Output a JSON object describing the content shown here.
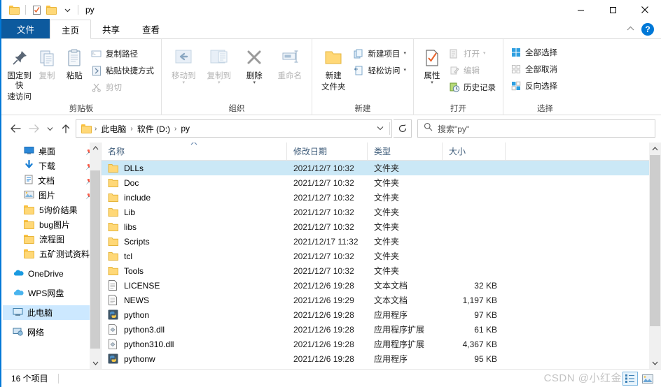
{
  "window": {
    "title": "py",
    "minimize": "—",
    "maximize": "□",
    "close": "✕",
    "collapse_ribbon": "⌃",
    "help": "?"
  },
  "quick_access": {
    "items": [
      {
        "name": "folder-icon",
        "label": ""
      },
      {
        "name": "properties-icon",
        "label": ""
      },
      {
        "name": "new-folder-icon",
        "label": ""
      },
      {
        "name": "customize-dropdown-icon",
        "label": "▾"
      }
    ]
  },
  "tabs": [
    {
      "label": "文件",
      "id": "file",
      "state": "file"
    },
    {
      "label": "主页",
      "id": "home",
      "state": "active"
    },
    {
      "label": "共享",
      "id": "share",
      "state": "normal"
    },
    {
      "label": "查看",
      "id": "view",
      "state": "normal"
    }
  ],
  "ribbon": {
    "groups": [
      {
        "id": "clipboard",
        "label": "剪贴板",
        "big": [
          {
            "label": "固定到快\n速访问",
            "line1": "固定到快",
            "line2": "速访问",
            "icon": "pin-icon",
            "dim": false
          },
          {
            "label": "复制",
            "line1": "复制",
            "line2": "",
            "icon": "copy-icon",
            "dim": true
          },
          {
            "label": "粘贴",
            "line1": "粘贴",
            "line2": "",
            "icon": "paste-icon",
            "dim": false
          }
        ],
        "small": [
          {
            "label": "复制路径",
            "icon": "copy-path-icon",
            "dim": false
          },
          {
            "label": "粘贴快捷方式",
            "icon": "paste-shortcut-icon",
            "dim": false
          },
          {
            "label": "剪切",
            "icon": "scissors-icon",
            "dim": true
          }
        ]
      },
      {
        "id": "organize",
        "label": "组织",
        "big": [
          {
            "line1": "移动到",
            "line2": "",
            "icon": "move-to-icon",
            "dim": true,
            "caret": true
          },
          {
            "line1": "复制到",
            "line2": "",
            "icon": "copy-to-icon",
            "dim": true,
            "caret": true
          },
          {
            "line1": "删除",
            "line2": "",
            "icon": "delete-icon",
            "dim": false,
            "caret": true
          },
          {
            "line1": "重命名",
            "line2": "",
            "icon": "rename-icon",
            "dim": true,
            "caret": false
          }
        ],
        "small": []
      },
      {
        "id": "new",
        "label": "新建",
        "big": [
          {
            "line1": "新建",
            "line2": "文件夹",
            "icon": "new-folder-icon",
            "dim": false
          }
        ],
        "small": [
          {
            "label": "新建项目",
            "icon": "new-item-icon",
            "dim": false,
            "caret": true
          },
          {
            "label": "轻松访问",
            "icon": "easy-access-icon",
            "dim": false,
            "caret": true
          }
        ]
      },
      {
        "id": "open",
        "label": "打开",
        "big": [
          {
            "line1": "属性",
            "line2": "",
            "icon": "properties-icon",
            "dim": false,
            "caret": true
          }
        ],
        "small": [
          {
            "label": "打开",
            "icon": "open-icon",
            "dim": true,
            "caret": true
          },
          {
            "label": "编辑",
            "icon": "edit-icon",
            "dim": true
          },
          {
            "label": "历史记录",
            "icon": "history-icon",
            "dim": false
          }
        ]
      },
      {
        "id": "select",
        "label": "选择",
        "big": [],
        "small": [
          {
            "label": "全部选择",
            "icon": "select-all-icon",
            "dim": false
          },
          {
            "label": "全部取消",
            "icon": "select-none-icon",
            "dim": false
          },
          {
            "label": "反向选择",
            "icon": "invert-selection-icon",
            "dim": false
          }
        ]
      }
    ]
  },
  "navbar": {
    "back": "←",
    "forward": "→",
    "recent": "⌄",
    "up": "↑",
    "breadcrumbs": [
      "此电脑",
      "软件 (D:)",
      "py"
    ],
    "dropdown": "⌄",
    "refresh": "↻"
  },
  "search": {
    "placeholder": "搜索\"py\"",
    "icon": "search-icon"
  },
  "sidebar": {
    "items": [
      {
        "label": "桌面",
        "icon": "desktop-icon",
        "pinned": true,
        "level": 2,
        "selected": false
      },
      {
        "label": "下载",
        "icon": "download-icon",
        "pinned": true,
        "level": 2,
        "selected": false
      },
      {
        "label": "文档",
        "icon": "documents-icon",
        "pinned": true,
        "level": 2,
        "selected": false
      },
      {
        "label": "图片",
        "icon": "pictures-icon",
        "pinned": true,
        "level": 2,
        "selected": false
      },
      {
        "label": "5询价结果",
        "icon": "folder-icon",
        "pinned": false,
        "level": 2,
        "selected": false
      },
      {
        "label": "bug图片",
        "icon": "folder-icon",
        "pinned": false,
        "level": 2,
        "selected": false
      },
      {
        "label": "流程图",
        "icon": "folder-icon",
        "pinned": false,
        "level": 2,
        "selected": false
      },
      {
        "label": "五矿测试资料",
        "icon": "folder-icon",
        "pinned": false,
        "level": 2,
        "selected": false
      },
      {
        "label": "OneDrive",
        "icon": "onedrive-icon",
        "pinned": false,
        "level": 1,
        "selected": false,
        "gap_before": true
      },
      {
        "label": "WPS网盘",
        "icon": "wps-cloud-icon",
        "pinned": false,
        "level": 1,
        "selected": false,
        "gap_before": true
      },
      {
        "label": "此电脑",
        "icon": "this-pc-icon",
        "pinned": false,
        "level": 1,
        "selected": true,
        "gap_before": true
      },
      {
        "label": "网络",
        "icon": "network-icon",
        "pinned": false,
        "level": 1,
        "selected": false,
        "gap_before": true
      }
    ]
  },
  "filelist": {
    "columns": [
      {
        "label": "名称",
        "key": "name",
        "sorted": true
      },
      {
        "label": "修改日期",
        "key": "date",
        "sorted": false
      },
      {
        "label": "类型",
        "key": "type",
        "sorted": false
      },
      {
        "label": "大小",
        "key": "size",
        "sorted": false
      }
    ],
    "rows": [
      {
        "name": "DLLs",
        "date": "2021/12/7 10:32",
        "type": "文件夹",
        "size": "",
        "icon": "folder-icon",
        "selected": true
      },
      {
        "name": "Doc",
        "date": "2021/12/7 10:32",
        "type": "文件夹",
        "size": "",
        "icon": "folder-icon",
        "selected": false
      },
      {
        "name": "include",
        "date": "2021/12/7 10:32",
        "type": "文件夹",
        "size": "",
        "icon": "folder-icon",
        "selected": false
      },
      {
        "name": "Lib",
        "date": "2021/12/7 10:32",
        "type": "文件夹",
        "size": "",
        "icon": "folder-icon",
        "selected": false
      },
      {
        "name": "libs",
        "date": "2021/12/7 10:32",
        "type": "文件夹",
        "size": "",
        "icon": "folder-icon",
        "selected": false
      },
      {
        "name": "Scripts",
        "date": "2021/12/17 11:32",
        "type": "文件夹",
        "size": "",
        "icon": "folder-icon",
        "selected": false
      },
      {
        "name": "tcl",
        "date": "2021/12/7 10:32",
        "type": "文件夹",
        "size": "",
        "icon": "folder-icon",
        "selected": false
      },
      {
        "name": "Tools",
        "date": "2021/12/7 10:32",
        "type": "文件夹",
        "size": "",
        "icon": "folder-icon",
        "selected": false
      },
      {
        "name": "LICENSE",
        "date": "2021/12/6 19:28",
        "type": "文本文档",
        "size": "32 KB",
        "icon": "text-file-icon",
        "selected": false
      },
      {
        "name": "NEWS",
        "date": "2021/12/6 19:29",
        "type": "文本文档",
        "size": "1,197 KB",
        "icon": "text-file-icon",
        "selected": false
      },
      {
        "name": "python",
        "date": "2021/12/6 19:28",
        "type": "应用程序",
        "size": "97 KB",
        "icon": "python-exe-icon",
        "selected": false
      },
      {
        "name": "python3.dll",
        "date": "2021/12/6 19:28",
        "type": "应用程序扩展",
        "size": "61 KB",
        "icon": "dll-icon",
        "selected": false
      },
      {
        "name": "python310.dll",
        "date": "2021/12/6 19:28",
        "type": "应用程序扩展",
        "size": "4,367 KB",
        "icon": "dll-icon",
        "selected": false
      },
      {
        "name": "pythonw",
        "date": "2021/12/6 19:28",
        "type": "应用程序",
        "size": "95 KB",
        "icon": "python-exe-icon",
        "selected": false
      }
    ]
  },
  "statusbar": {
    "item_count": "16 个项目",
    "watermark": "CSDN @小红金",
    "view_details_icon": "details-view-icon",
    "view_thumbnails_icon": "thumbnail-view-icon"
  },
  "colors": {
    "accent": "#0078d7",
    "file_tab": "#0d5a9e",
    "selection": "#cbe8f6",
    "sidebar_selection": "#cce8ff",
    "folder": "#ffd877"
  }
}
